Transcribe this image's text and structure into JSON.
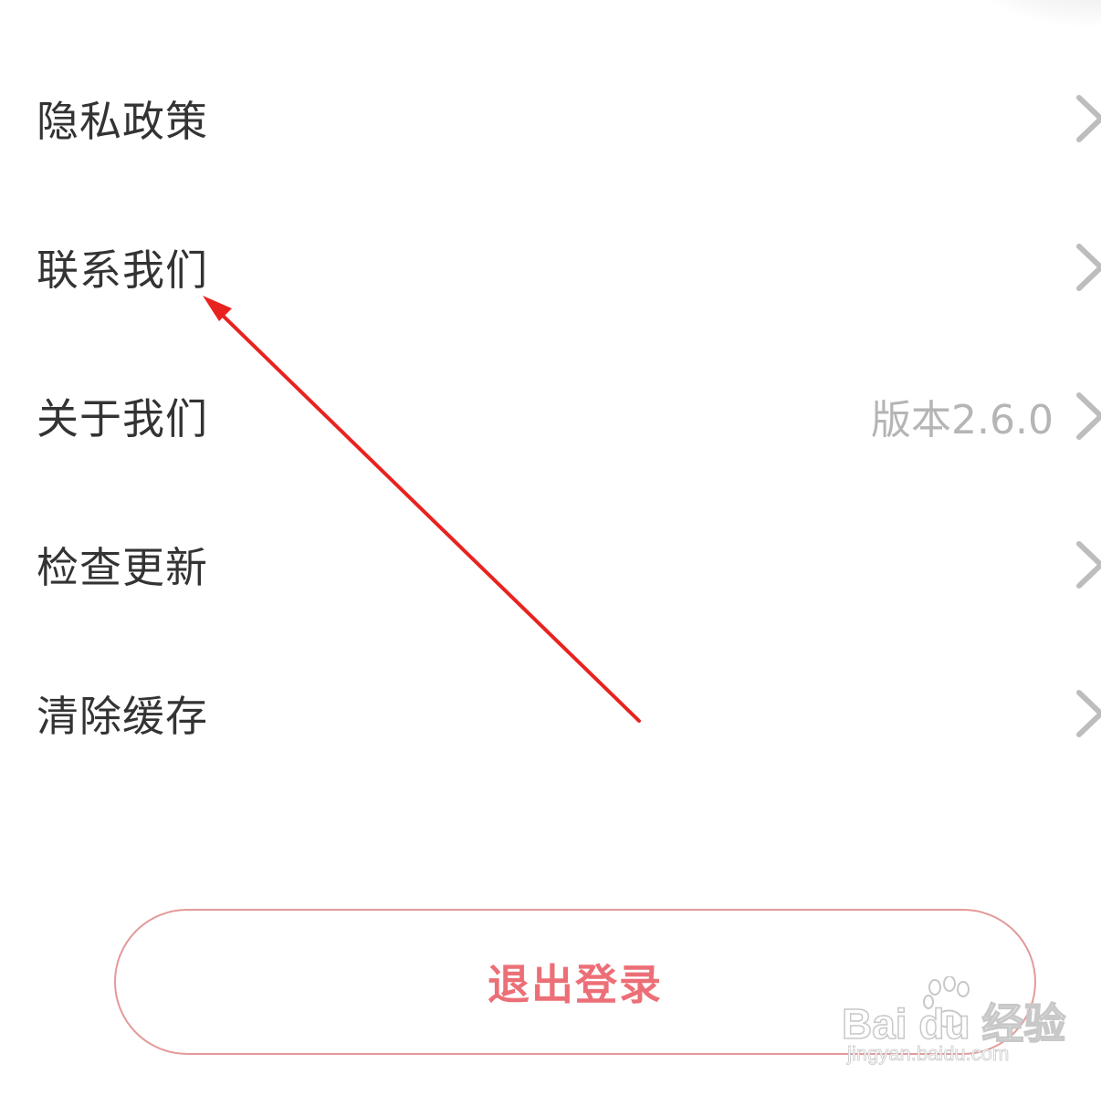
{
  "menu": {
    "items": [
      {
        "label": "隐私政策",
        "value": "",
        "icon": "chevron-right-icon"
      },
      {
        "label": "联系我们",
        "value": "",
        "icon": "chevron-right-icon"
      },
      {
        "label": "关于我们",
        "value": "版本2.6.0",
        "icon": "chevron-right-icon"
      },
      {
        "label": "检查更新",
        "value": "",
        "icon": "chevron-right-icon"
      },
      {
        "label": "清除缓存",
        "value": "",
        "icon": "chevron-right-icon"
      }
    ]
  },
  "logout": {
    "label": "退出登录"
  },
  "watermark": {
    "main": "Bai du 经验",
    "sub": "jingyan.baidu.com"
  },
  "colors": {
    "label_text": "#333333",
    "value_text": "#b5b5b5",
    "chevron": "#bdbdbd",
    "logout_text": "#ec6f77",
    "logout_border": "#e39a9a",
    "annotation_arrow": "#e8231f"
  }
}
